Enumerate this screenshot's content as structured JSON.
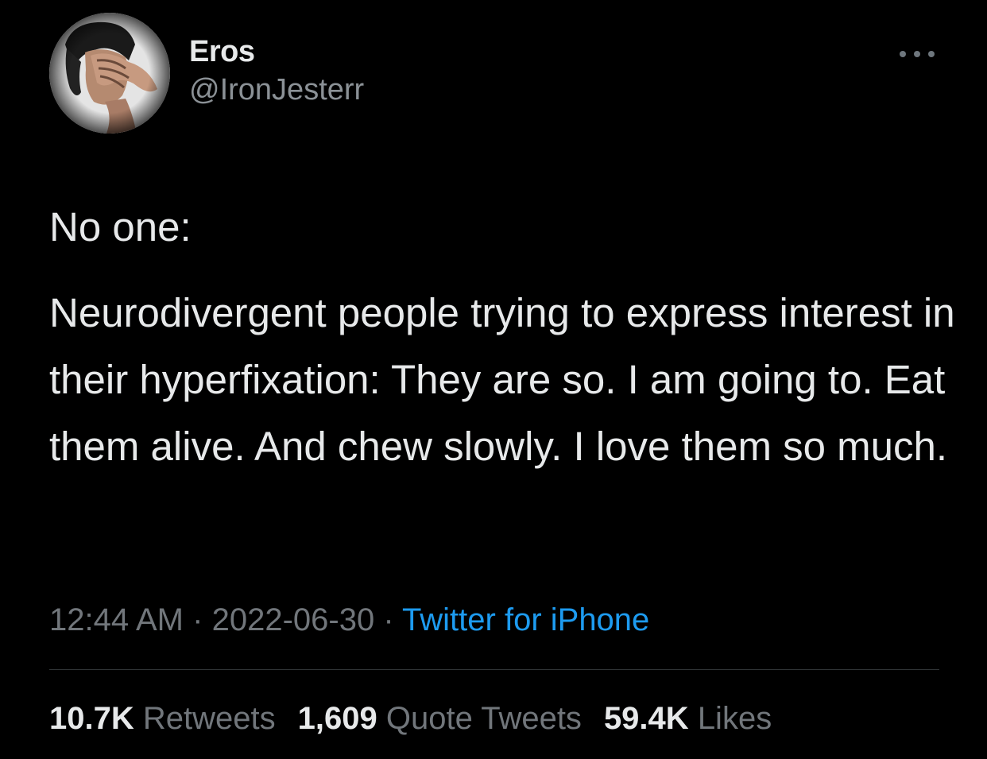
{
  "user": {
    "display_name": "Eros",
    "handle": "@IronJesterr"
  },
  "tweet": {
    "paragraphs": [
      "No one:",
      "Neurodivergent people trying to express interest in their hyperfixation: They are so. I am going to. Eat them alive. And chew slowly. I love them so much."
    ],
    "time": "12:44 AM",
    "date": "2022-06-30",
    "separator": "·",
    "source": "Twitter for iPhone"
  },
  "stats": [
    {
      "count": "10.7K",
      "label": "Retweets"
    },
    {
      "count": "1,609",
      "label": "Quote Tweets"
    },
    {
      "count": "59.4K",
      "label": "Likes"
    }
  ],
  "icons": {
    "more": "more-horizontal-icon"
  },
  "colors": {
    "background": "#000000",
    "text": "#e7e9ea",
    "secondary": "#71767b",
    "link": "#1d9bf0",
    "divider": "#2f3336"
  }
}
